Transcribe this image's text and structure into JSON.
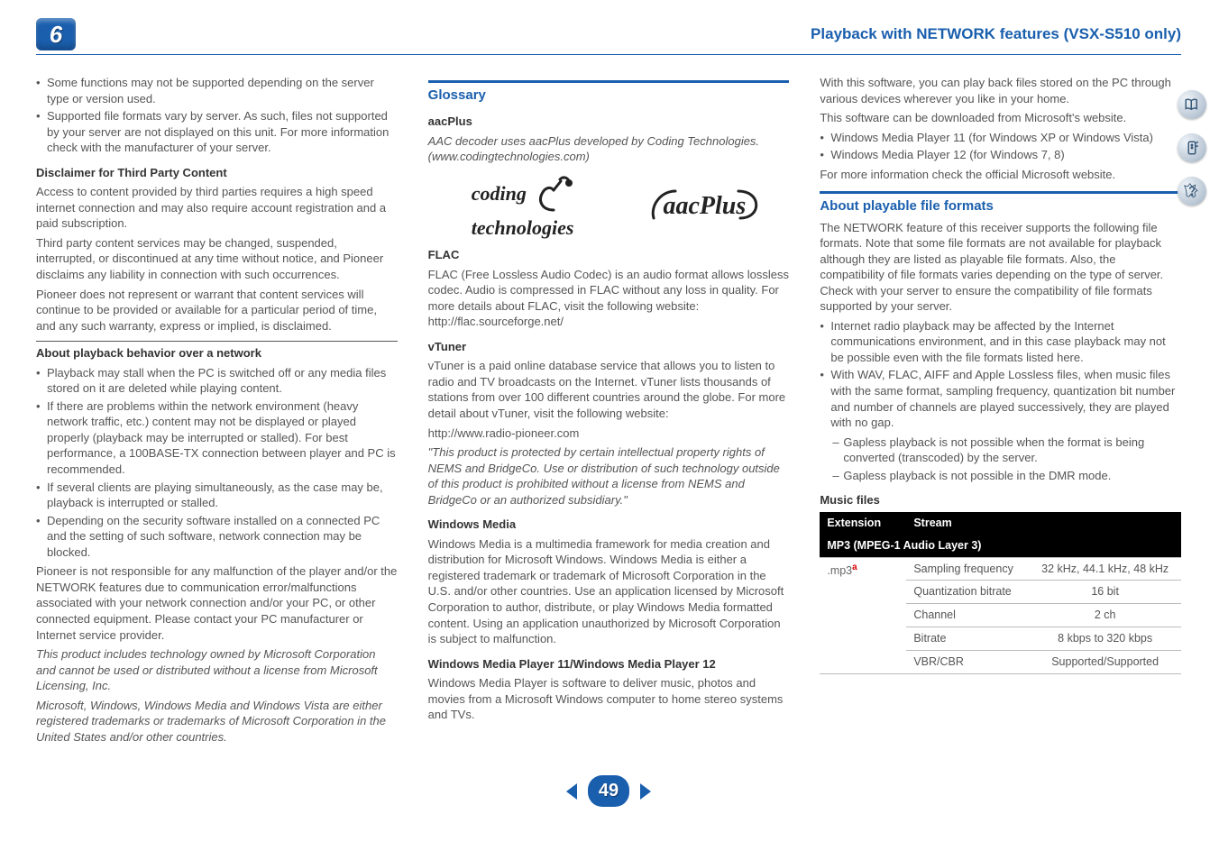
{
  "header": {
    "chapter_number": "6",
    "title": "Playback with NETWORK features (VSX-S510 only)"
  },
  "col1": {
    "top_bullets": [
      "Some functions may not be supported depending on the server type or version used.",
      "Supported file formats vary by server. As such, files not supported by your server are not displayed on this unit. For more information check with the manufacturer of your server."
    ],
    "disclaimer_heading": "Disclaimer for Third Party Content",
    "disclaimer_p1": "Access to content provided by third parties requires a high speed internet connection and may also require account registration and a paid subscription.",
    "disclaimer_p2": "Third party content services may be changed, suspended, interrupted, or discontinued at any time without notice, and Pioneer disclaims any liability in connection with such occurrences.",
    "disclaimer_p3": "Pioneer does not represent or warrant that content services will continue to be provided or available for a particular period of time, and any such warranty, express or implied, is disclaimed.",
    "behavior_heading": "About playback behavior over a network",
    "behavior_bullets": [
      "Playback may stall when the PC is switched off or any media files stored on it are deleted while playing content.",
      "If there are problems within the network environment (heavy network traffic, etc.) content may not be displayed or played properly (playback may be interrupted or stalled). For best performance, a 100BASE-TX connection between player and PC is recommended.",
      "If several clients are playing simultaneously, as the case may be, playback is interrupted or stalled.",
      "Depending on the security software installed on a connected PC and the setting of such software, network connection may be blocked."
    ],
    "behavior_foot": "Pioneer is not responsible for any malfunction of the player and/or the NETWORK features due to communication error/malfunctions associated with your network connection and/or your PC, or other connected equipment. Please contact your PC manufacturer or Internet service provider.",
    "italic_p1": "This product includes technology owned by Microsoft Corporation and cannot be used or distributed without a license from Microsoft Licensing, Inc.",
    "italic_p2": "Microsoft, Windows, Windows Media and Windows Vista are either registered trademarks or trademarks of Microsoft Corporation in the United States and/or other countries."
  },
  "col2": {
    "glossary_heading": "Glossary",
    "aacplus_heading": "aacPlus",
    "aacplus_text": "AAC decoder uses aacPlus developed by Coding Technologies. (www.codingtechnologies.com)",
    "coding_logo_line1": "coding",
    "coding_logo_line2": "technologies",
    "aacplus_logo_text": "aacPlus",
    "flac_heading": "FLAC",
    "flac_text": "FLAC (Free Lossless Audio Codec) is an audio format allows lossless codec. Audio is compressed in FLAC without any loss in quality. For more details about FLAC, visit the following website: http://flac.sourceforge.net/",
    "vtuner_heading": "vTuner",
    "vtuner_p1": "vTuner is a paid online database service that allows you to listen to radio and TV broadcasts on the Internet. vTuner lists thousands of stations from over 100 different countries around the globe. For more detail about vTuner, visit the following website:",
    "vtuner_url": "http://www.radio-pioneer.com",
    "vtuner_italic": "\"This product is protected by certain intellectual property rights of NEMS and BridgeCo. Use or distribution of such technology outside of this product is prohibited without a license from NEMS and BridgeCo or an authorized subsidiary.\"",
    "winmedia_heading": "Windows Media",
    "winmedia_text": "Windows Media is a multimedia framework for media creation and distribution for Microsoft Windows. Windows Media is either a registered trademark or trademark of Microsoft Corporation in the U.S. and/or other countries. Use an application licensed by Microsoft Corporation to author, distribute, or play Windows Media formatted content. Using an application unauthorized by Microsoft Corporation is subject to malfunction.",
    "wmp_heading": "Windows Media Player 11/Windows Media Player 12",
    "wmp_text": "Windows Media Player is software to deliver music, photos and movies from a Microsoft Windows computer to home stereo systems and TVs."
  },
  "col3": {
    "intro_p1": "With this software, you can play back files stored on the PC through various devices wherever you like in your home.",
    "intro_p2": "This software can be downloaded from Microsoft's website.",
    "intro_bullets": [
      "Windows Media Player 11 (for Windows XP or Windows Vista)",
      "Windows Media Player 12 (for Windows 7, 8)"
    ],
    "intro_foot": "For more information check the official Microsoft website.",
    "formats_heading": "About playable file formats",
    "formats_p1": "The NETWORK feature of this receiver supports the following file formats. Note that some file formats are not available for playback although they are listed as playable file formats. Also, the compatibility of file formats varies depending on the type of server. Check with your server to ensure the compatibility of file formats supported by your server.",
    "formats_bullets": [
      "Internet radio playback may be affected by the Internet communications environment, and in this case playback may not be possible even with the file formats listed here.",
      "With WAV, FLAC, AIFF and Apple Lossless files, when music files with the same format, sampling frequency, quantization bit number and number of channels are played successively, they are played with no gap."
    ],
    "formats_dashes": [
      "Gapless playback is not possible when the format is being converted (transcoded) by the server.",
      "Gapless playback is not possible in the DMR mode."
    ],
    "music_heading": "Music files",
    "table": {
      "head_ext": "Extension",
      "head_stream": "Stream",
      "section": "MP3 (MPEG-1 Audio Layer 3)",
      "ext": ".mp3",
      "sup": "a",
      "rows": [
        {
          "label": "Sampling frequency",
          "value": "32 kHz, 44.1 kHz, 48 kHz"
        },
        {
          "label": "Quantization bitrate",
          "value": "16 bit"
        },
        {
          "label": "Channel",
          "value": "2 ch"
        },
        {
          "label": "Bitrate",
          "value": "8 kbps to 320 kbps"
        },
        {
          "label": "VBR/CBR",
          "value": "Supported/Supported"
        }
      ]
    }
  },
  "pager": {
    "page_number": "49"
  }
}
